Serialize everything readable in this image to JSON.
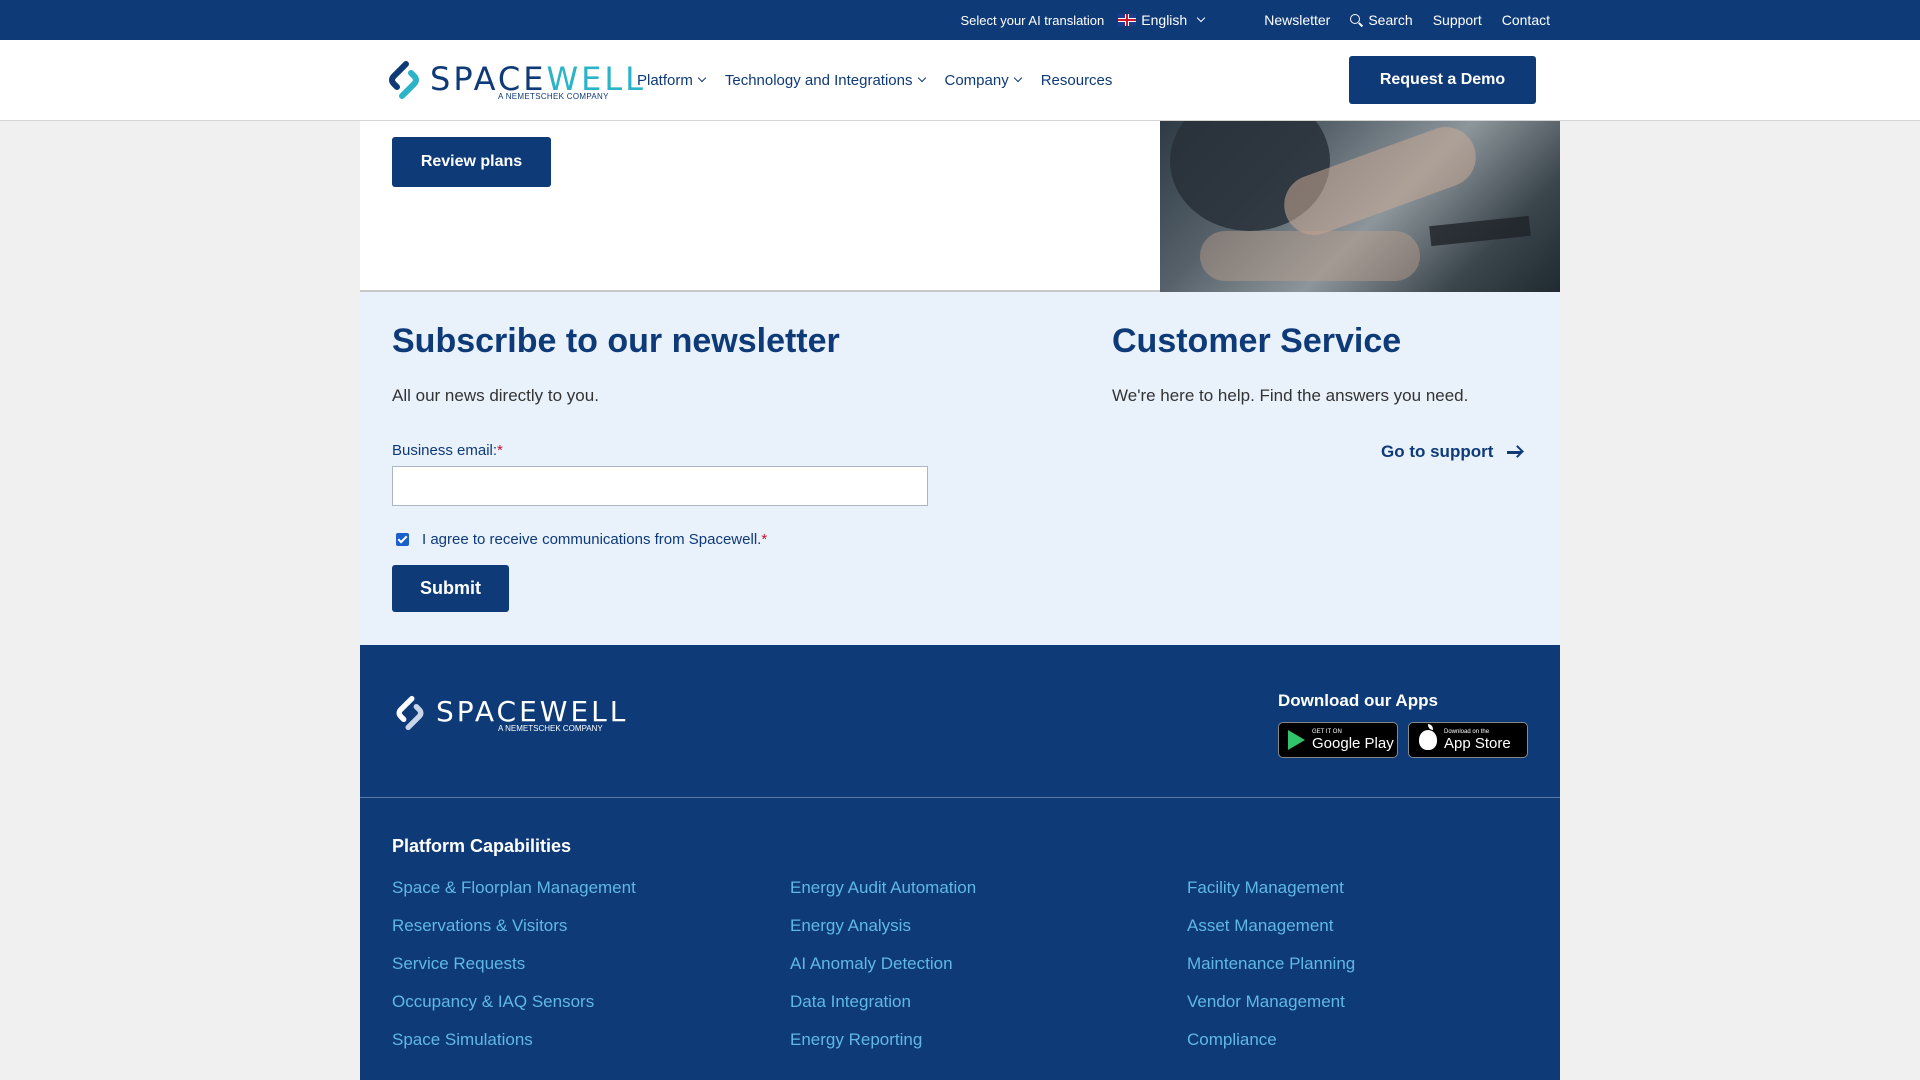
{
  "topbar": {
    "translate_label": "Select your AI translation",
    "language": "English",
    "links": [
      "Newsletter",
      "Search",
      "Support",
      "Contact"
    ]
  },
  "header": {
    "logo_word_a": "SPACE",
    "logo_word_b": "WELL",
    "logo_sub": "A NEMETSCHEK COMPANY",
    "nav": [
      "Platform",
      "Technology and Integrations",
      "Company",
      "Resources"
    ],
    "cta": "Request a Demo"
  },
  "hero": {
    "button": "Review plans"
  },
  "newsletter": {
    "title": "Subscribe to our newsletter",
    "subtitle": "All our news directly to you.",
    "email_label": "Business email:",
    "required_mark": "*",
    "email_value": "",
    "consent": "I agree to receive communications from Spacewell.",
    "submit": "Submit"
  },
  "customer_service": {
    "title": "Customer Service",
    "subtitle": "We're here to help. Find the answers you need.",
    "link": "Go to support"
  },
  "footer": {
    "logo_word": "SPACEWELL",
    "logo_sub": "A NEMETSCHEK COMPANY",
    "apps_title": "Download our Apps",
    "google_small": "GET IT ON",
    "google_big": "Google Play",
    "apple_small": "Download on the",
    "apple_big": "App Store",
    "capabilities_title": "Platform Capabilities",
    "col1": [
      "Space & Floorplan Management",
      "Reservations & Visitors",
      "Service Requests",
      "Occupancy & IAQ Sensors",
      "Space Simulations"
    ],
    "col2": [
      "Energy Audit Automation",
      "Energy Analysis",
      "AI Anomaly Detection",
      "Data Integration",
      "Energy Reporting"
    ],
    "col3": [
      "Facility Management",
      "Asset Management",
      "Maintenance Planning",
      "Vendor Management",
      "Compliance"
    ]
  },
  "colors": {
    "brand_navy": "#0e3a78",
    "accent_teal": "#2bb3c8",
    "footer_link": "#5fb8e6",
    "section_bg": "#e9f1fb"
  }
}
